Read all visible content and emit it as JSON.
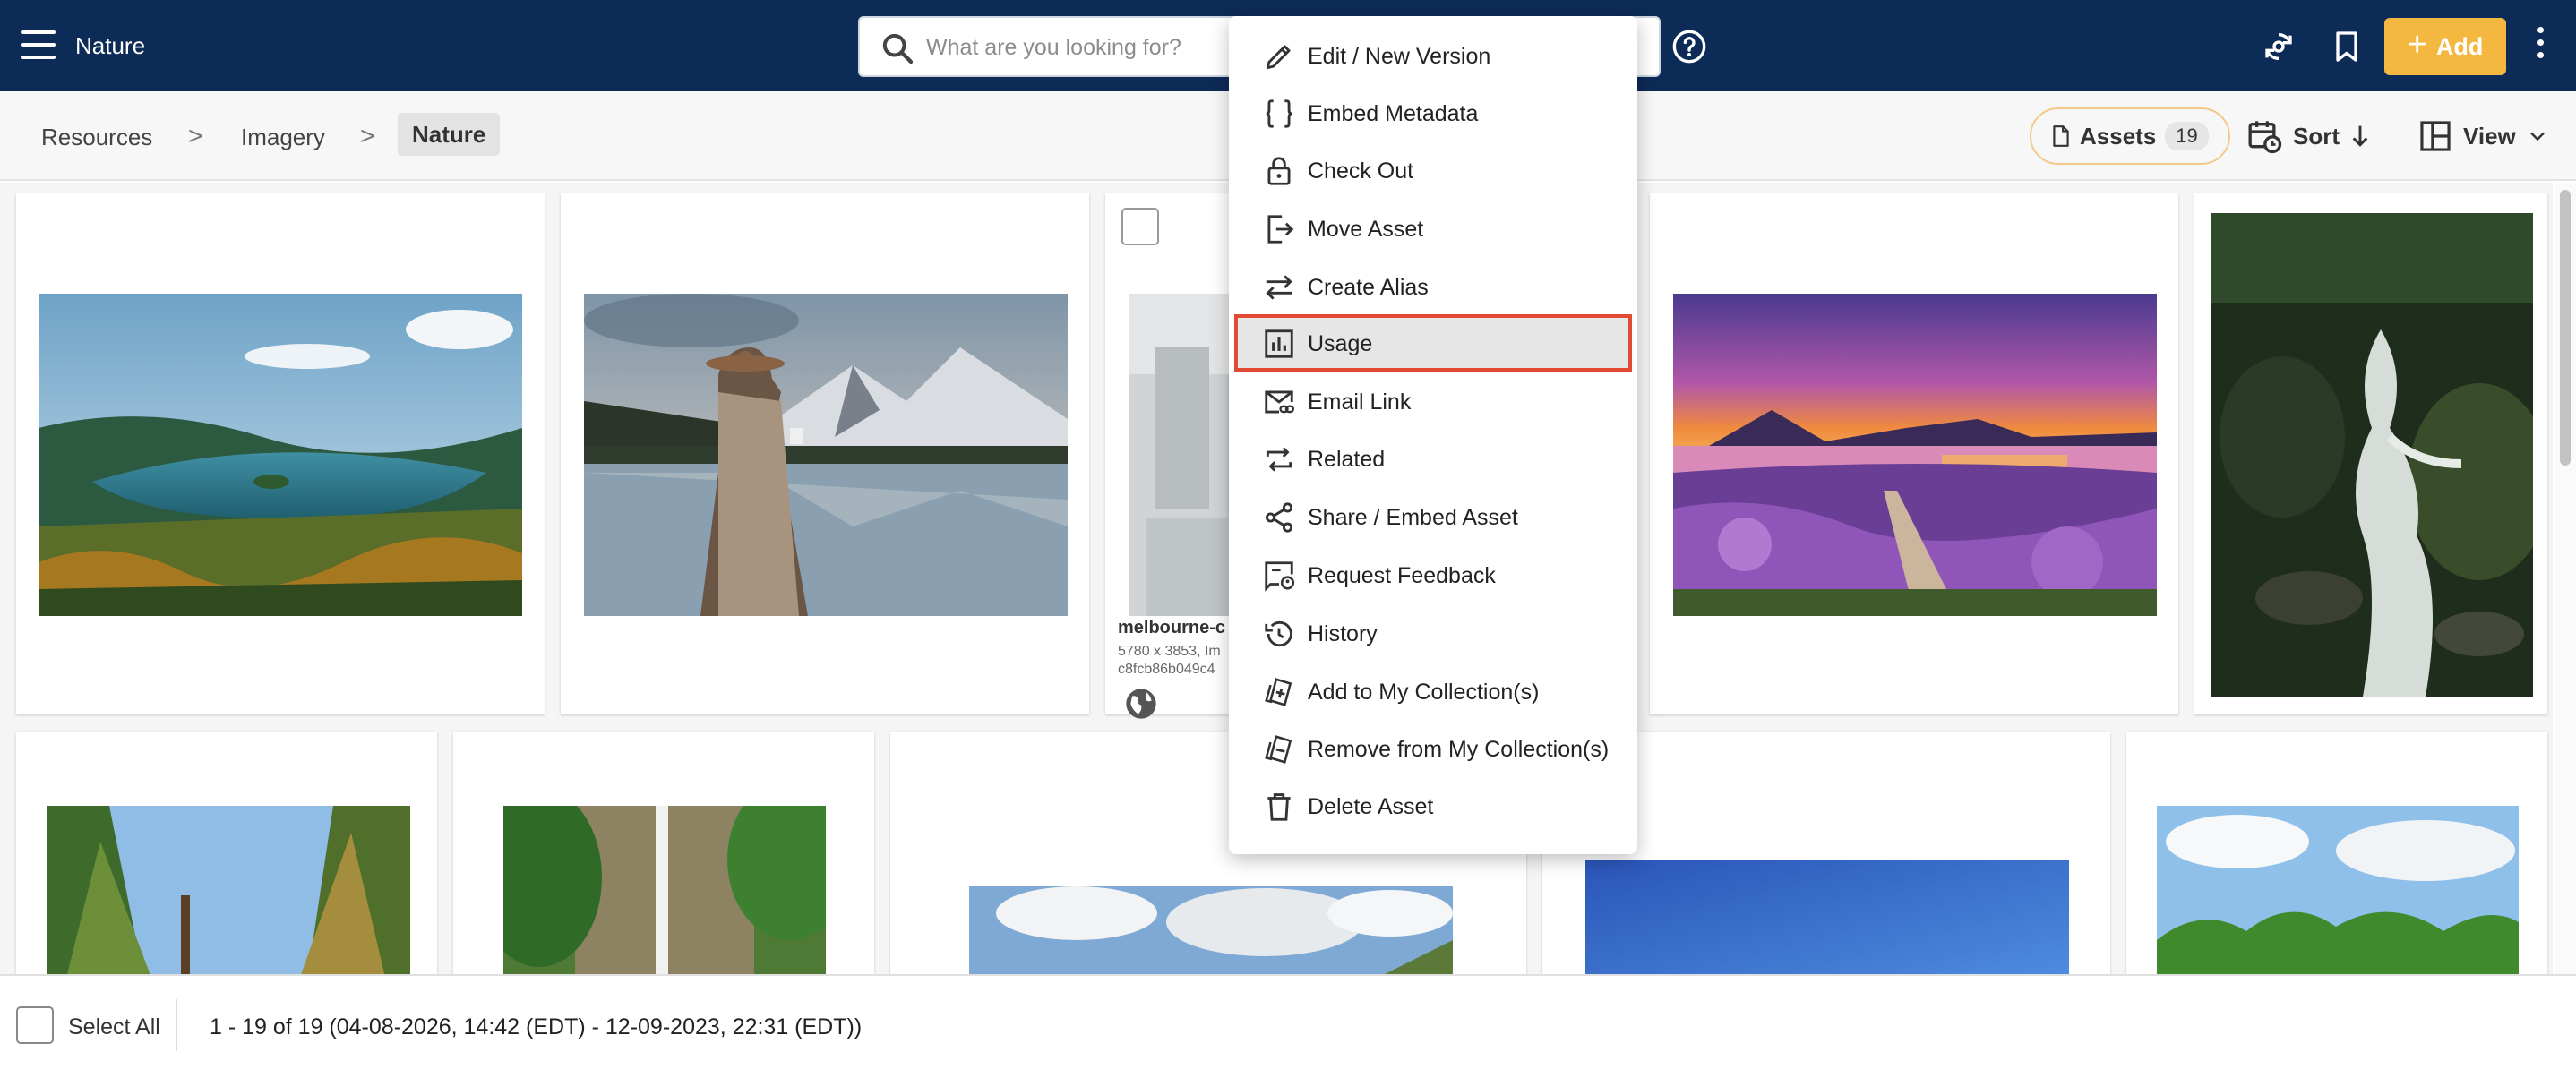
{
  "topbar": {
    "title": "Nature",
    "search_placeholder": "What are you looking for?",
    "add_label": "Add",
    "icons": [
      "menu-icon",
      "search-icon",
      "help-icon",
      "sync-icon",
      "bookmark-icon",
      "more-vert-icon"
    ]
  },
  "breadcrumb": {
    "items": [
      "Resources",
      "Imagery",
      "Nature"
    ],
    "separator": ">"
  },
  "toolbar": {
    "assets_label": "Assets",
    "assets_count": "19",
    "sort_label": "Sort",
    "view_label": "View"
  },
  "cards": {
    "card3": {
      "title": "melbourne-c",
      "meta_line1": "5780 x 3853, Im",
      "meta_line2": "c8fcb86b049c4"
    }
  },
  "context_menu": {
    "items": [
      {
        "label": "Edit / New Version",
        "icon": "pencil-icon"
      },
      {
        "label": "Embed Metadata",
        "icon": "braces-icon"
      },
      {
        "label": "Check Out",
        "icon": "lock-icon"
      },
      {
        "label": "Move Asset",
        "icon": "move-icon"
      },
      {
        "label": "Create Alias",
        "icon": "swap-icon"
      },
      {
        "label": "Usage",
        "icon": "bar-chart-icon",
        "highlighted": true
      },
      {
        "label": "Email Link",
        "icon": "email-link-icon"
      },
      {
        "label": "Related",
        "icon": "related-icon"
      },
      {
        "label": "Share / Embed Asset",
        "icon": "share-icon"
      },
      {
        "label": "Request Feedback",
        "icon": "feedback-icon"
      },
      {
        "label": "History",
        "icon": "history-icon"
      },
      {
        "label": "Add to My Collection(s)",
        "icon": "collection-add-icon"
      },
      {
        "label": "Remove from My Collection(s)",
        "icon": "collection-remove-icon"
      },
      {
        "label": "Delete Asset",
        "icon": "trash-icon"
      }
    ]
  },
  "footer": {
    "select_all_label": "Select All",
    "range_text": "1 - 19 of 19 (04-08-2026, 14:42 (EDT) - 12-09-2023, 22:31 (EDT))"
  },
  "colors": {
    "topbar": "#0d2b57",
    "accent": "#f4b73f",
    "highlight_border": "#e34a35"
  }
}
